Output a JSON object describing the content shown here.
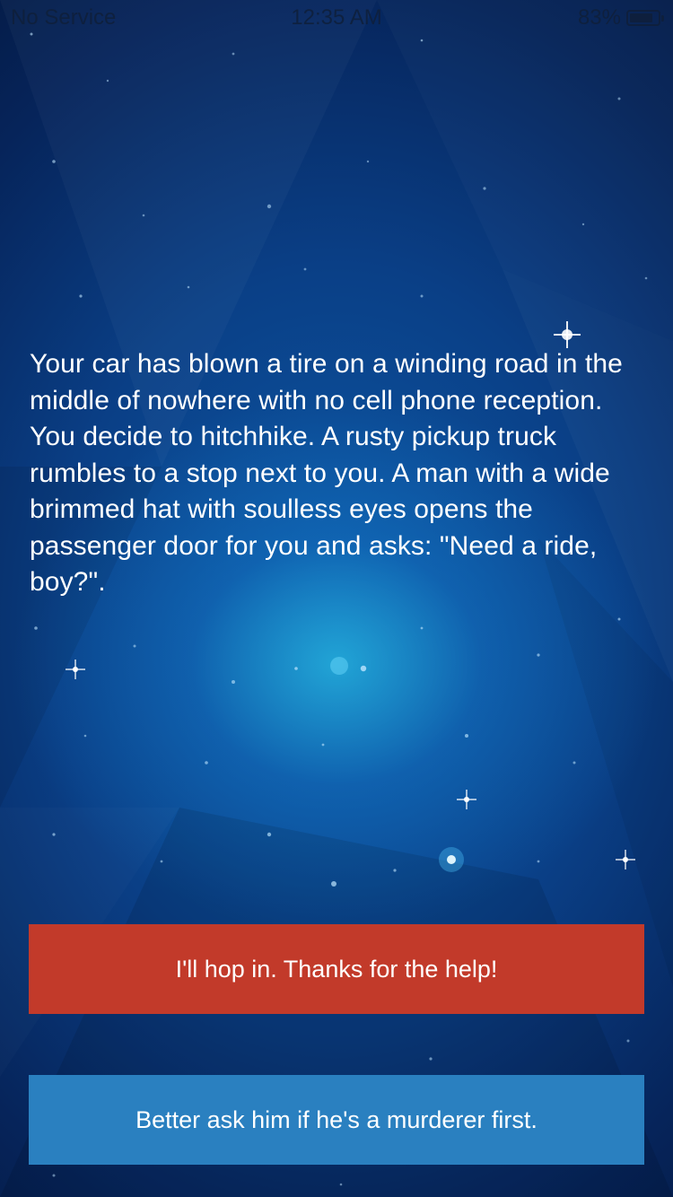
{
  "status_bar": {
    "carrier": "No Service",
    "time": "12:35 AM",
    "battery_percent": "83%",
    "battery_level": 0.83,
    "icons": [
      "battery-icon"
    ]
  },
  "story": {
    "text": "Your car has blown a tire on a winding road in the middle of nowhere with no cell phone reception. You decide to hitchhike. A rusty pickup truck rumbles to a stop next to you. A man with a wide brimmed hat with soulless eyes opens the passenger door for you and asks: \"Need a ride, boy?\"."
  },
  "choices": [
    {
      "label": "I'll hop in. Thanks for the help!",
      "color": "#c23a2a"
    },
    {
      "label": "Better ask him if he's a murderer first.",
      "color": "#2a80c0"
    }
  ],
  "theme": {
    "background_color": "#0a3f86",
    "text_color": "#ffffff"
  }
}
